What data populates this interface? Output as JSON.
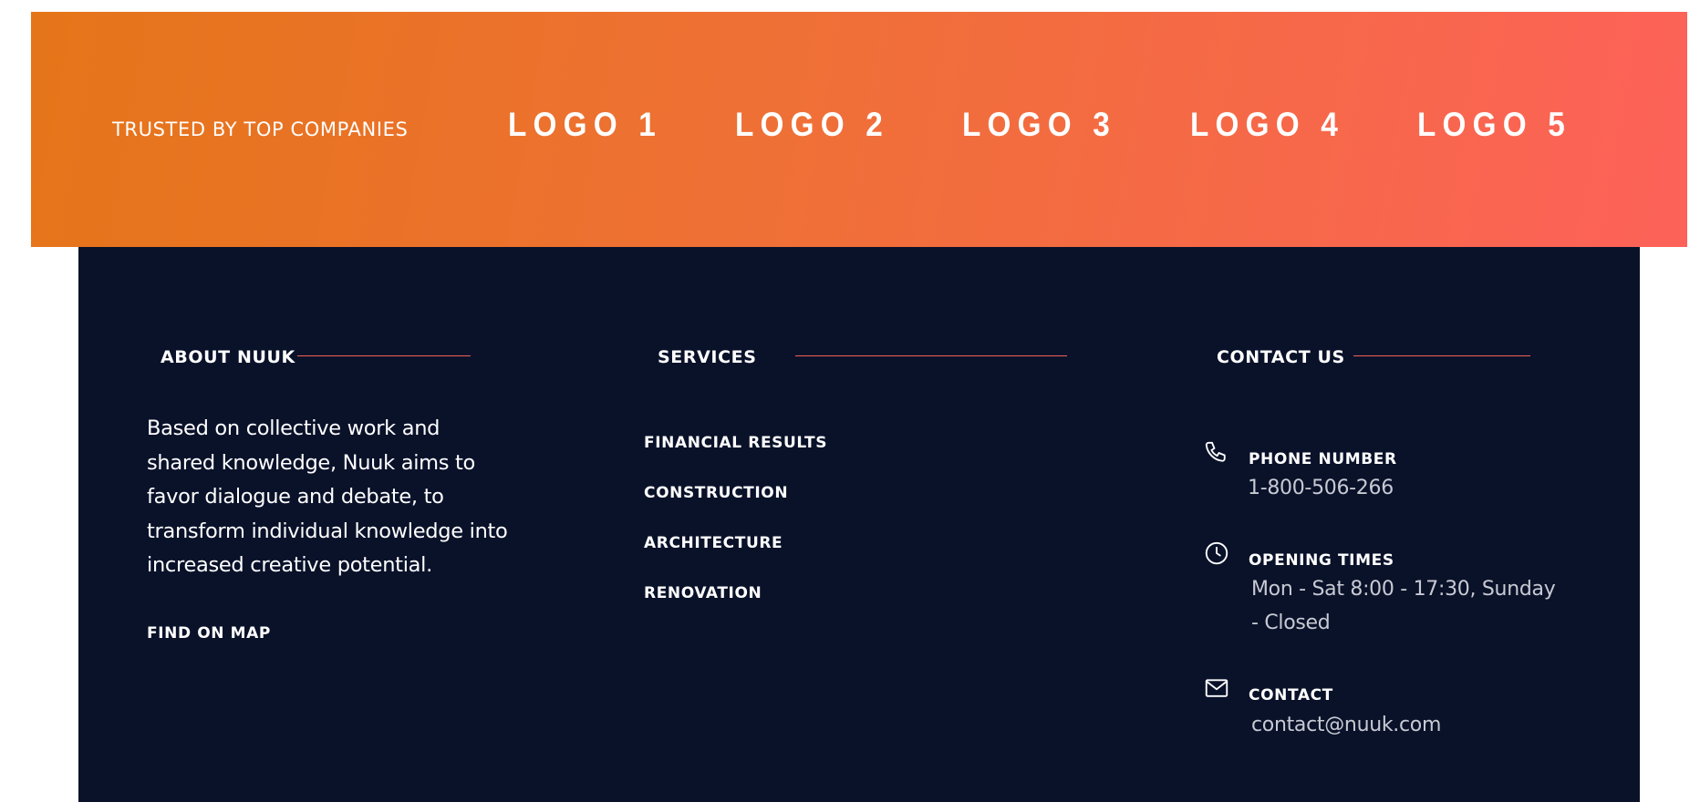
{
  "trusted": {
    "title": "TRUSTED BY TOP COMPANIES",
    "logos": [
      "LOGO 1",
      "LOGO 2",
      "LOGO 3",
      "LOGO 4",
      "LOGO 5"
    ]
  },
  "footer": {
    "about": {
      "heading": "ABOUT NUUK",
      "text": "Based on collective work and shared knowledge, Nuuk aims to favor dialogue and debate, to transform individual knowledge into increased creative potential.",
      "map_link": "FIND ON MAP"
    },
    "services": {
      "heading": "SERVICES",
      "items": [
        "FINANCIAL RESULTS",
        "CONSTRUCTION",
        "ARCHITECTURE",
        "RENOVATION"
      ]
    },
    "contact": {
      "heading": "CONTACT US",
      "phone": {
        "label": "PHONE NUMBER",
        "value": "1-800-506-266",
        "icon": "phone-icon"
      },
      "hours": {
        "label": "OPENING TIMES",
        "value": "Mon - Sat 8:00 - 17:30, Sunday - Closed",
        "icon": "clock-icon"
      },
      "email": {
        "label": "CONTACT",
        "value": "contact@nuuk.com",
        "icon": "mail-icon"
      }
    }
  },
  "colors": {
    "gradient_start": "#e57519",
    "gradient_end": "#fd6259",
    "footer_bg": "#0a122a",
    "accent_rule": "#f26159",
    "muted_text": "#c8cad3"
  }
}
